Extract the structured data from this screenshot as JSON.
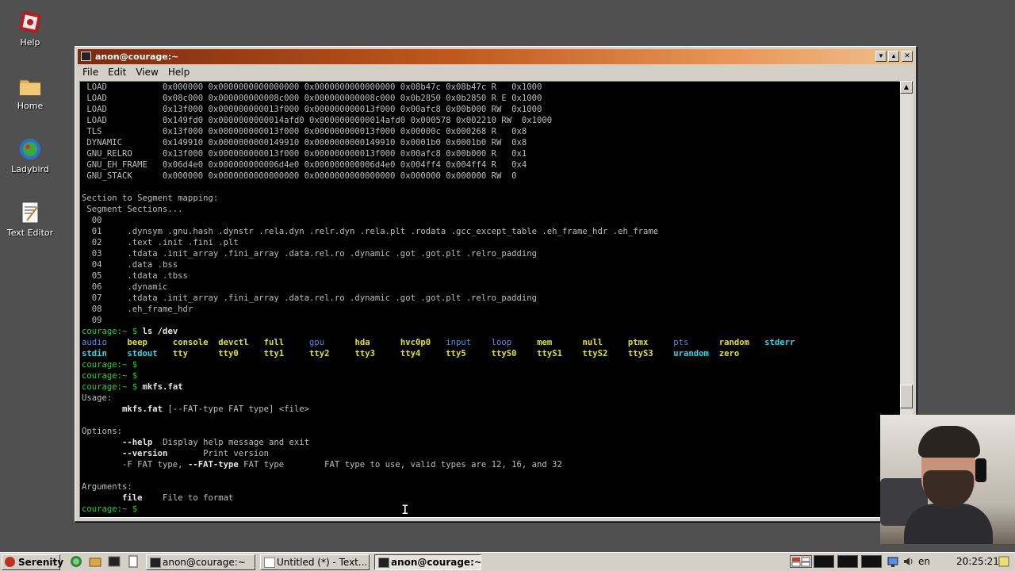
{
  "desktop": {
    "icons": [
      {
        "label": "Help",
        "icon": "help-icon"
      },
      {
        "label": "Home",
        "icon": "folder-icon"
      },
      {
        "label": "Ladybird",
        "icon": "ladybird-icon"
      },
      {
        "label": "Text Editor",
        "icon": "text-editor-icon"
      }
    ]
  },
  "window": {
    "title": "anon@courage:~",
    "menu": [
      "File",
      "Edit",
      "View",
      "Help"
    ],
    "buttons": {
      "minimize": "▾",
      "maximize": "▴",
      "close": "✕"
    }
  },
  "terminal": {
    "segments": [
      {
        "type": "LOAD",
        "offset": "0x000000",
        "vaddr": "0x0000000000000000",
        "paddr": "0x0000000000000000",
        "filesz": "0x08b47c",
        "memsz": "0x08b47c",
        "flg": "R  ",
        "align": "0x1000"
      },
      {
        "type": "LOAD",
        "offset": "0x08c000",
        "vaddr": "0x000000000008c000",
        "paddr": "0x000000000008c000",
        "filesz": "0x0b2850",
        "memsz": "0x0b2850",
        "flg": "R E",
        "align": "0x1000"
      },
      {
        "type": "LOAD",
        "offset": "0x13f000",
        "vaddr": "0x000000000013f000",
        "paddr": "0x000000000013f000",
        "filesz": "0x00afc8",
        "memsz": "0x00b000",
        "flg": "RW ",
        "align": "0x1000"
      },
      {
        "type": "LOAD",
        "offset": "0x149fd0",
        "vaddr": "0x0000000000014afd0",
        "paddr": "0x0000000000014afd0",
        "filesz": "0x000578",
        "memsz": "0x002210",
        "flg": "RW ",
        "align": "0x1000"
      },
      {
        "type": "TLS",
        "offset": "0x13f000",
        "vaddr": "0x000000000013f000",
        "paddr": "0x000000000013f000",
        "filesz": "0x00000c",
        "memsz": "0x000268",
        "flg": "R  ",
        "align": "0x8"
      },
      {
        "type": "DYNAMIC",
        "offset": "0x149910",
        "vaddr": "0x0000000000149910",
        "paddr": "0x0000000000149910",
        "filesz": "0x0001b0",
        "memsz": "0x0001b0",
        "flg": "RW ",
        "align": "0x8"
      },
      {
        "type": "GNU_RELRO",
        "offset": "0x13f000",
        "vaddr": "0x000000000013f000",
        "paddr": "0x000000000013f000",
        "filesz": "0x00afc8",
        "memsz": "0x00b000",
        "flg": "R  ",
        "align": "0x1"
      },
      {
        "type": "GNU_EH_FRAME",
        "offset": "0x06d4e0",
        "vaddr": "0x000000000006d4e0",
        "paddr": "0x000000000006d4e0",
        "filesz": "0x004ff4",
        "memsz": "0x004ff4",
        "flg": "R  ",
        "align": "0x4"
      },
      {
        "type": "GNU_STACK",
        "offset": "0x000000",
        "vaddr": "0x0000000000000000",
        "paddr": "0x0000000000000000",
        "filesz": "0x000000",
        "memsz": "0x000000",
        "flg": "RW ",
        "align": "0"
      }
    ],
    "mapping_header": "Section to Segment mapping:",
    "mapping_subheader": "Segment Sections...",
    "mapping": [
      {
        "seg": "00",
        "sections": ""
      },
      {
        "seg": "01",
        "sections": ".dynsym .gnu.hash .dynstr .rela.dyn .relr.dyn .rela.plt .rodata .gcc_except_table .eh_frame_hdr .eh_frame"
      },
      {
        "seg": "02",
        "sections": ".text .init .fini .plt"
      },
      {
        "seg": "03",
        "sections": ".tdata .init_array .fini_array .data.rel.ro .dynamic .got .got.plt .relro_padding"
      },
      {
        "seg": "04",
        "sections": ".data .bss"
      },
      {
        "seg": "05",
        "sections": ".tdata .tbss"
      },
      {
        "seg": "06",
        "sections": ".dynamic"
      },
      {
        "seg": "07",
        "sections": ".tdata .init_array .fini_array .data.rel.ro .dynamic .got .got.plt .relro_padding"
      },
      {
        "seg": "08",
        "sections": ".eh_frame_hdr"
      },
      {
        "seg": "09",
        "sections": ""
      }
    ],
    "prompt": "courage:~ $",
    "ls_command": "ls /dev",
    "ls_row1": [
      {
        "name": "audio",
        "kind": "blue"
      },
      {
        "name": "beep",
        "kind": "yellow"
      },
      {
        "name": "console",
        "kind": "yellow"
      },
      {
        "name": "devctl",
        "kind": "yellow"
      },
      {
        "name": "full",
        "kind": "yellow"
      },
      {
        "name": "gpu",
        "kind": "blue"
      },
      {
        "name": "hda",
        "kind": "yellow"
      },
      {
        "name": "hvc0p0",
        "kind": "yellow"
      },
      {
        "name": "input",
        "kind": "blue"
      },
      {
        "name": "loop",
        "kind": "blue"
      },
      {
        "name": "mem",
        "kind": "yellow"
      },
      {
        "name": "null",
        "kind": "yellow"
      },
      {
        "name": "ptmx",
        "kind": "yellow"
      },
      {
        "name": "pts",
        "kind": "blue"
      },
      {
        "name": "random",
        "kind": "yellow"
      },
      {
        "name": "stderr",
        "kind": "cyan"
      }
    ],
    "ls_row2": [
      {
        "name": "stdin",
        "kind": "cyan"
      },
      {
        "name": "stdout",
        "kind": "cyan"
      },
      {
        "name": "tty",
        "kind": "yellow"
      },
      {
        "name": "tty0",
        "kind": "yellow"
      },
      {
        "name": "tty1",
        "kind": "yellow"
      },
      {
        "name": "tty2",
        "kind": "yellow"
      },
      {
        "name": "tty3",
        "kind": "yellow"
      },
      {
        "name": "tty4",
        "kind": "yellow"
      },
      {
        "name": "tty5",
        "kind": "yellow"
      },
      {
        "name": "ttyS0",
        "kind": "yellow"
      },
      {
        "name": "ttyS1",
        "kind": "yellow"
      },
      {
        "name": "ttyS2",
        "kind": "yellow"
      },
      {
        "name": "ttyS3",
        "kind": "yellow"
      },
      {
        "name": "urandom",
        "kind": "cyan"
      },
      {
        "name": "zero",
        "kind": "yellow"
      }
    ],
    "mkfs_command": "mkfs.fat",
    "usage_label": "Usage:",
    "usage_cmd": "mkfs.fat",
    "usage_args": " [--FAT-type FAT type] <file>",
    "options_label": "Options:",
    "opt_help_flag": "--help",
    "opt_help_desc": "Display help message and exit",
    "opt_version_flag": "--version",
    "opt_version_desc": "Print version",
    "opt_fat_short": "-F FAT type, ",
    "opt_fat_long": "--FAT-type",
    "opt_fat_arg": " FAT type",
    "opt_fat_desc": "FAT type to use, valid types are 12, 16, and 32",
    "arguments_label": "Arguments:",
    "arg_file": "file",
    "arg_file_desc": "File to format"
  },
  "taskbar": {
    "start_label": "Serenity",
    "tasks": [
      {
        "label": "anon@courage:~",
        "active": false
      },
      {
        "label": "Untitled (*) - Text...",
        "active": false
      },
      {
        "label": "anon@courage:~",
        "active": true
      }
    ],
    "language": "en",
    "clock": "20:25:21"
  },
  "colors": {
    "terminal_bg": "#000000",
    "prompt_green": "#2bd02b",
    "device_yellow": "#e0e030",
    "dir_blue": "#5a8ce8",
    "link_cyan": "#30d8e8",
    "titlebar_start": "#7a2a10",
    "titlebar_end": "#f0c090"
  }
}
